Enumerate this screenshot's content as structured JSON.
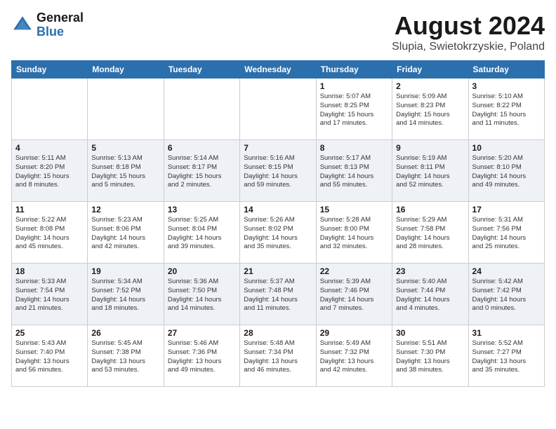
{
  "header": {
    "logo_general": "General",
    "logo_blue": "Blue",
    "month_year": "August 2024",
    "location": "Slupia, Swietokrzyskie, Poland"
  },
  "days_of_week": [
    "Sunday",
    "Monday",
    "Tuesday",
    "Wednesday",
    "Thursday",
    "Friday",
    "Saturday"
  ],
  "weeks": [
    [
      {
        "day": "",
        "info": ""
      },
      {
        "day": "",
        "info": ""
      },
      {
        "day": "",
        "info": ""
      },
      {
        "day": "",
        "info": ""
      },
      {
        "day": "1",
        "info": "Sunrise: 5:07 AM\nSunset: 8:25 PM\nDaylight: 15 hours\nand 17 minutes."
      },
      {
        "day": "2",
        "info": "Sunrise: 5:09 AM\nSunset: 8:23 PM\nDaylight: 15 hours\nand 14 minutes."
      },
      {
        "day": "3",
        "info": "Sunrise: 5:10 AM\nSunset: 8:22 PM\nDaylight: 15 hours\nand 11 minutes."
      }
    ],
    [
      {
        "day": "4",
        "info": "Sunrise: 5:11 AM\nSunset: 8:20 PM\nDaylight: 15 hours\nand 8 minutes."
      },
      {
        "day": "5",
        "info": "Sunrise: 5:13 AM\nSunset: 8:18 PM\nDaylight: 15 hours\nand 5 minutes."
      },
      {
        "day": "6",
        "info": "Sunrise: 5:14 AM\nSunset: 8:17 PM\nDaylight: 15 hours\nand 2 minutes."
      },
      {
        "day": "7",
        "info": "Sunrise: 5:16 AM\nSunset: 8:15 PM\nDaylight: 14 hours\nand 59 minutes."
      },
      {
        "day": "8",
        "info": "Sunrise: 5:17 AM\nSunset: 8:13 PM\nDaylight: 14 hours\nand 55 minutes."
      },
      {
        "day": "9",
        "info": "Sunrise: 5:19 AM\nSunset: 8:11 PM\nDaylight: 14 hours\nand 52 minutes."
      },
      {
        "day": "10",
        "info": "Sunrise: 5:20 AM\nSunset: 8:10 PM\nDaylight: 14 hours\nand 49 minutes."
      }
    ],
    [
      {
        "day": "11",
        "info": "Sunrise: 5:22 AM\nSunset: 8:08 PM\nDaylight: 14 hours\nand 45 minutes."
      },
      {
        "day": "12",
        "info": "Sunrise: 5:23 AM\nSunset: 8:06 PM\nDaylight: 14 hours\nand 42 minutes."
      },
      {
        "day": "13",
        "info": "Sunrise: 5:25 AM\nSunset: 8:04 PM\nDaylight: 14 hours\nand 39 minutes."
      },
      {
        "day": "14",
        "info": "Sunrise: 5:26 AM\nSunset: 8:02 PM\nDaylight: 14 hours\nand 35 minutes."
      },
      {
        "day": "15",
        "info": "Sunrise: 5:28 AM\nSunset: 8:00 PM\nDaylight: 14 hours\nand 32 minutes."
      },
      {
        "day": "16",
        "info": "Sunrise: 5:29 AM\nSunset: 7:58 PM\nDaylight: 14 hours\nand 28 minutes."
      },
      {
        "day": "17",
        "info": "Sunrise: 5:31 AM\nSunset: 7:56 PM\nDaylight: 14 hours\nand 25 minutes."
      }
    ],
    [
      {
        "day": "18",
        "info": "Sunrise: 5:33 AM\nSunset: 7:54 PM\nDaylight: 14 hours\nand 21 minutes."
      },
      {
        "day": "19",
        "info": "Sunrise: 5:34 AM\nSunset: 7:52 PM\nDaylight: 14 hours\nand 18 minutes."
      },
      {
        "day": "20",
        "info": "Sunrise: 5:36 AM\nSunset: 7:50 PM\nDaylight: 14 hours\nand 14 minutes."
      },
      {
        "day": "21",
        "info": "Sunrise: 5:37 AM\nSunset: 7:48 PM\nDaylight: 14 hours\nand 11 minutes."
      },
      {
        "day": "22",
        "info": "Sunrise: 5:39 AM\nSunset: 7:46 PM\nDaylight: 14 hours\nand 7 minutes."
      },
      {
        "day": "23",
        "info": "Sunrise: 5:40 AM\nSunset: 7:44 PM\nDaylight: 14 hours\nand 4 minutes."
      },
      {
        "day": "24",
        "info": "Sunrise: 5:42 AM\nSunset: 7:42 PM\nDaylight: 14 hours\nand 0 minutes."
      }
    ],
    [
      {
        "day": "25",
        "info": "Sunrise: 5:43 AM\nSunset: 7:40 PM\nDaylight: 13 hours\nand 56 minutes."
      },
      {
        "day": "26",
        "info": "Sunrise: 5:45 AM\nSunset: 7:38 PM\nDaylight: 13 hours\nand 53 minutes."
      },
      {
        "day": "27",
        "info": "Sunrise: 5:46 AM\nSunset: 7:36 PM\nDaylight: 13 hours\nand 49 minutes."
      },
      {
        "day": "28",
        "info": "Sunrise: 5:48 AM\nSunset: 7:34 PM\nDaylight: 13 hours\nand 46 minutes."
      },
      {
        "day": "29",
        "info": "Sunrise: 5:49 AM\nSunset: 7:32 PM\nDaylight: 13 hours\nand 42 minutes."
      },
      {
        "day": "30",
        "info": "Sunrise: 5:51 AM\nSunset: 7:30 PM\nDaylight: 13 hours\nand 38 minutes."
      },
      {
        "day": "31",
        "info": "Sunrise: 5:52 AM\nSunset: 7:27 PM\nDaylight: 13 hours\nand 35 minutes."
      }
    ]
  ]
}
